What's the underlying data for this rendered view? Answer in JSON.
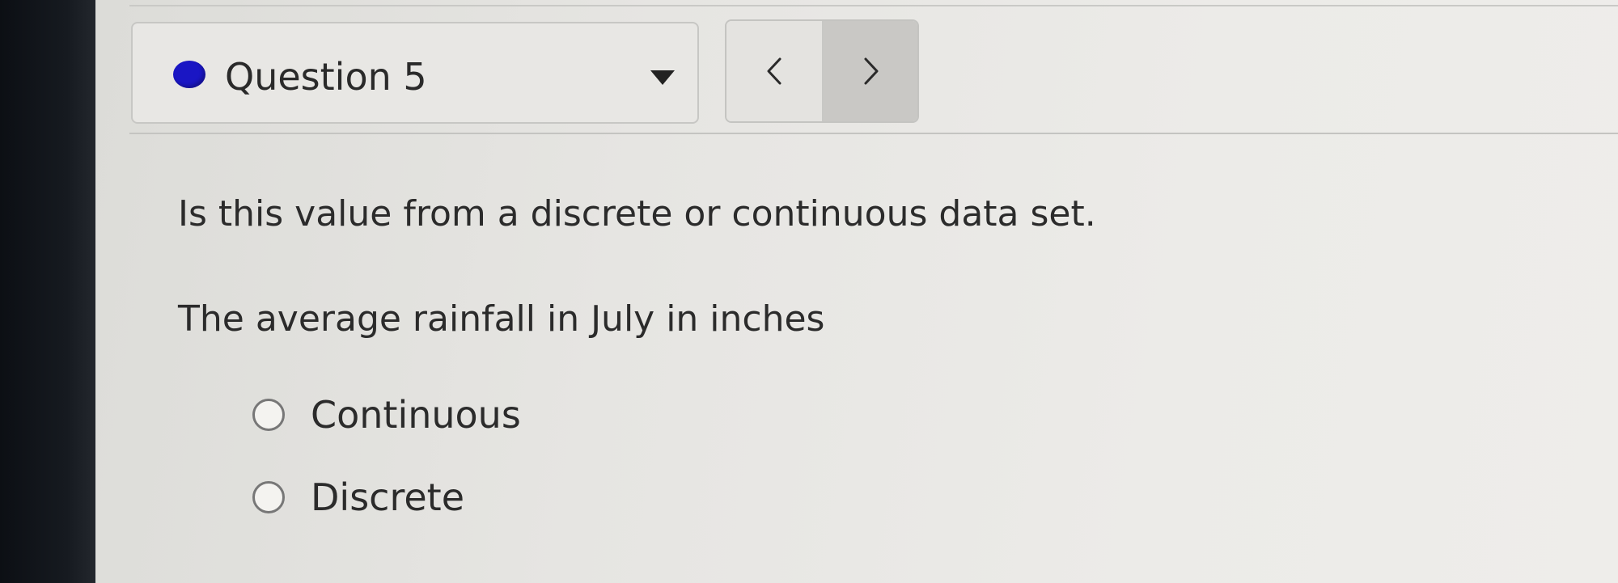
{
  "header": {
    "question_select": {
      "label": "Question 5",
      "status_color": "#1a16c4",
      "caret_icon": "chevron-down-filled-icon"
    },
    "pager": {
      "prev_icon": "chevron-left-icon",
      "next_icon": "chevron-right-icon"
    }
  },
  "question": {
    "text": "Is this value from a discrete or continuous data set.",
    "prompt": "The average rainfall in July in inches",
    "options": [
      {
        "label": "Continuous",
        "selected": false
      },
      {
        "label": "Discrete",
        "selected": false
      }
    ]
  }
}
